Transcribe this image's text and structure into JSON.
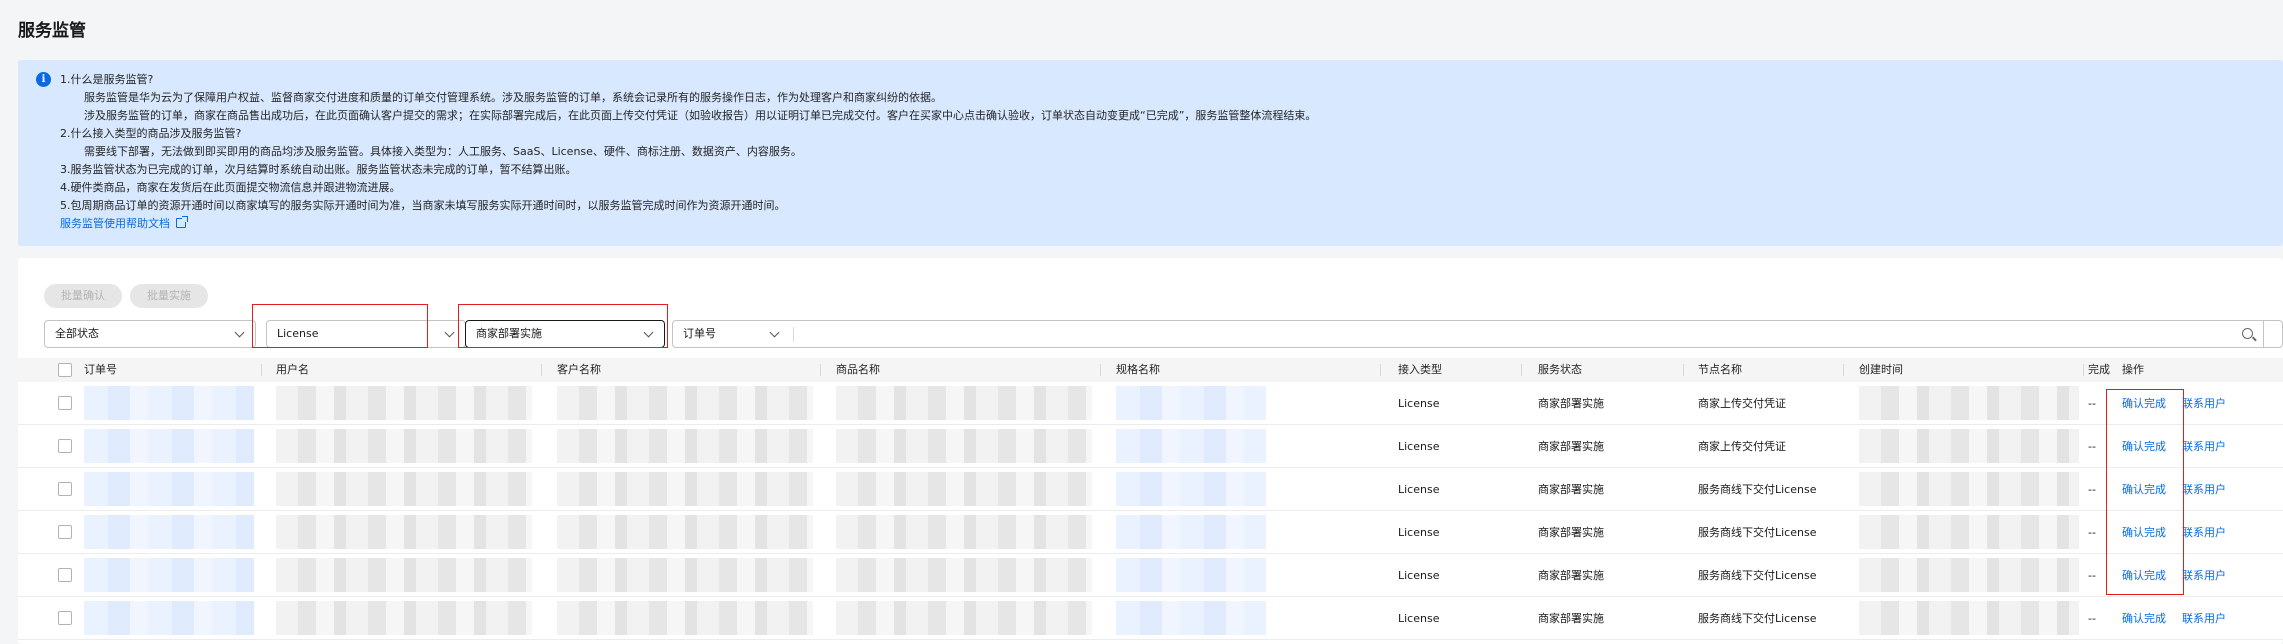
{
  "page": {
    "title": "服务监管"
  },
  "notice": {
    "lines": [
      "1.什么是服务监管?",
      "服务监管是华为云为了保障用户权益、监督商家交付进度和质量的订单交付管理系统。涉及服务监管的订单，系统会记录所有的服务操作日志，作为处理客户和商家纠纷的依据。",
      "涉及服务监管的订单，商家在商品售出成功后，在此页面确认客户提交的需求；在实际部署完成后，在此页面上传交付凭证（如验收报告）用以证明订单已完成交付。客户在买家中心点击确认验收，订单状态自动变更成“已完成”，服务监管整体流程结束。",
      "2.什么接入类型的商品涉及服务监管?",
      "需要线下部署，无法做到即买即用的商品均涉及服务监管。具体接入类型为：人工服务、SaaS、License、硬件、商标注册、数据资产、内容服务。",
      "3.服务监管状态为已完成的订单，次月结算时系统自动出账。服务监管状态未完成的订单，暂不结算出账。",
      "4.硬件类商品，商家在发货后在此页面提交物流信息并跟进物流进展。",
      "5.包周期商品订单的资源开通时间以商家填写的服务实际开通时间为准，当商家未填写服务实际开通时间时，以服务监管完成时间作为资源开通时间。"
    ],
    "help_link": "服务监管使用帮助文档"
  },
  "toolbar": {
    "batch_confirm": "批量确认",
    "batch_deploy": "批量实施",
    "status_filter": "全部状态",
    "access_type_filter": "License",
    "service_type_filter": "商家部署实施",
    "search_key": "订单号",
    "search_placeholder": ""
  },
  "table": {
    "headers": {
      "order_no": "订单号",
      "user_name": "用户名",
      "customer_name": "客户名称",
      "product_name": "商品名称",
      "spec_name": "规格名称",
      "access_type": "接入类型",
      "service_status": "服务状态",
      "node_name": "节点名称",
      "create_time": "创建时间",
      "complete": "完成",
      "actions": "操作"
    },
    "rows": [
      {
        "access_type": "License",
        "service_status": "商家部署实施",
        "node_name": "商家上传交付凭证",
        "complete": "--",
        "action_confirm": "确认完成",
        "action_contact": "联系用户"
      },
      {
        "access_type": "License",
        "service_status": "商家部署实施",
        "node_name": "商家上传交付凭证",
        "complete": "--",
        "action_confirm": "确认完成",
        "action_contact": "联系用户"
      },
      {
        "access_type": "License",
        "service_status": "商家部署实施",
        "node_name": "服务商线下交付License",
        "complete": "--",
        "action_confirm": "确认完成",
        "action_contact": "联系用户"
      },
      {
        "access_type": "License",
        "service_status": "商家部署实施",
        "node_name": "服务商线下交付License",
        "complete": "--",
        "action_confirm": "确认完成",
        "action_contact": "联系用户"
      },
      {
        "access_type": "License",
        "service_status": "商家部署实施",
        "node_name": "服务商线下交付License",
        "complete": "--",
        "action_confirm": "确认完成",
        "action_contact": "联系用户"
      },
      {
        "access_type": "License",
        "service_status": "商家部署实施",
        "node_name": "服务商线下交付License",
        "complete": "--",
        "action_confirm": "确认完成",
        "action_contact": "联系用户"
      }
    ]
  },
  "colors": {
    "accent": "#0a6be0",
    "notice_bg": "#d7e8ff",
    "highlight": "#e02020"
  }
}
